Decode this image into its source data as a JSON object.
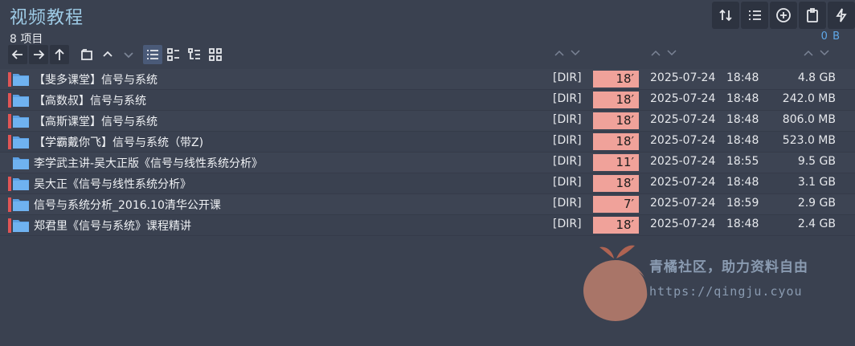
{
  "header": {
    "title": "视频教程",
    "item_count": "8 项目",
    "total_size": "0 B"
  },
  "toolbar_right": [
    {
      "name": "sort-icon"
    },
    {
      "name": "list-view-icon"
    },
    {
      "name": "add-icon"
    },
    {
      "name": "clipboard-icon"
    },
    {
      "name": "lightning-icon"
    }
  ],
  "nav": [
    "back-arrow-icon",
    "forward-arrow-icon",
    "up-arrow-icon",
    "folder-open-icon",
    "caret-up-icon",
    "caret-down-icon",
    "details-view-icon",
    "small-icons-view-icon",
    "tree-view-icon",
    "grid-view-icon"
  ],
  "files": [
    {
      "name": "【斐多课堂】信号与系统",
      "type": "[DIR]",
      "count": "18′",
      "date": "2025-07-24",
      "time": "18:48",
      "size": "4.8 GB"
    },
    {
      "name": "【高数叔】信号与系统",
      "type": "[DIR]",
      "count": "18′",
      "date": "2025-07-24",
      "time": "18:48",
      "size": "242.0 MB"
    },
    {
      "name": "【高斯课堂】信号与系统",
      "type": "[DIR]",
      "count": "18′",
      "date": "2025-07-24",
      "time": "18:48",
      "size": "806.0 MB"
    },
    {
      "name": "【学霸戴你飞】信号与系统（带Z)",
      "type": "[DIR]",
      "count": "18′",
      "date": "2025-07-24",
      "time": "18:48",
      "size": "523.0 MB"
    },
    {
      "name": "李学武主讲-吴大正版《信号与线性系统分析》",
      "type": "[DIR]",
      "count": "11′",
      "date": "2025-07-24",
      "time": "18:55",
      "size": "9.5 GB"
    },
    {
      "name": "吴大正《信号与线性系统分析》",
      "type": "[DIR]",
      "count": "18′",
      "date": "2025-07-24",
      "time": "18:48",
      "size": "3.1 GB"
    },
    {
      "name": "信号与系统分析_2016.10清华公开课",
      "type": "[DIR]",
      "count": "7′",
      "date": "2025-07-24",
      "time": "18:59",
      "size": "2.9 GB"
    },
    {
      "name": "郑君里《信号与系统》课程精讲",
      "type": "[DIR]",
      "count": "18′",
      "date": "2025-07-24",
      "time": "18:48",
      "size": "2.4 GB"
    }
  ],
  "watermark": {
    "line1": "青橘社区，助力资料自由",
    "line2": "https://qingju.cyou"
  },
  "colors": {
    "background": "#3a4150",
    "accent": "#9ecbe6",
    "count_bar": "#f0a29a",
    "marker": "#e05555",
    "folder": "#5b9fe3"
  }
}
